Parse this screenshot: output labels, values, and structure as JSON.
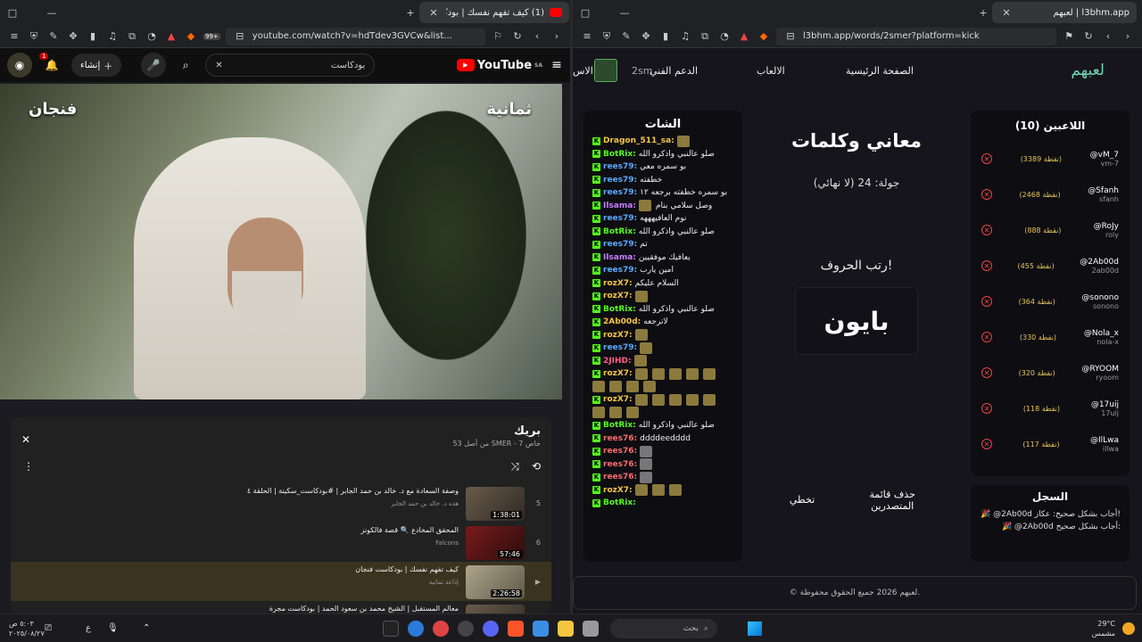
{
  "left_window": {
    "tab_title": "(1) كيف تفهم نفسك | بودكاست...",
    "url": "youtube.com/watch?v=hdTdev3GVCw&list...",
    "badge_count": "99+",
    "youtube": {
      "logo_text": "YouTube",
      "logo_region": "SA",
      "search_value": "بودكاست",
      "create_label": "إنشاء",
      "notification_count": "1",
      "video_label_left": "فنجان",
      "video_label_right": "ثمانية"
    },
    "playlist": {
      "title": "بريك",
      "subtitle": "خاص SMER - 7 من أصل 53",
      "items": [
        {
          "num": "5",
          "title": "وصفة السعادة مع د. خالد بن حمد الجابر | #بودكاست_سكينة | الحلقة ٤",
          "channel": "هذه د. خالد بن حمد الجابر",
          "duration": "1:38:01"
        },
        {
          "num": "6",
          "title": "المحقق المخادع 🔍 قصة فالكونز",
          "channel": "Falcons",
          "duration": "57:46"
        },
        {
          "num": "▶",
          "title": "كيف تفهم نفسك | بودكاست فنجان",
          "channel": "إذاعة ثمانية",
          "duration": "2:26:58"
        },
        {
          "num": "",
          "title": "معالم المستقبل | الشيخ محمد بن سعود الحمد | بودكاست مجرة",
          "channel": "",
          "duration": ""
        }
      ]
    }
  },
  "right_window": {
    "tab_title": "لعبهم | l3bhm.app",
    "url": "l3bhm.app/words/2smer?platform=kick",
    "site": {
      "logo": "لعبهم",
      "nav_home": "الصفحة الرئيسية",
      "nav_games": "الالعاب",
      "nav_support": "الدعم الفني",
      "nav_user": "2sm",
      "nav_cut": "الاس",
      "chat_title": "الشات",
      "game_title": "معاني وكلمات",
      "round_text": "جولة: 24 (لا نهائي)",
      "prompt": "رتب الحروف!",
      "word": "بايون",
      "action_delete": "حذف قائمة المتصدرين",
      "action_skip": "تخطي",
      "players_title": "اللاعبين (10)",
      "log_title": "السجل",
      "log_entries": [
        "🎉 @2Ab00d أجاب بشكل صحيح: عكاز!",
        "🎉 @2Ab00d أجاب بشكل صحيح:"
      ],
      "footer": "© لعبهم 2026 جميع الحقوق محفوظة."
    },
    "players": [
      {
        "name": "@vM_7",
        "user": "vm-7",
        "points": "(3389 نقطة)"
      },
      {
        "name": "@Sfanh",
        "user": "sfanh",
        "points": "(2468 نقطة)"
      },
      {
        "name": "@RoJy",
        "user": "roly",
        "points": "(888 نقطة)"
      },
      {
        "name": "@2Ab00d",
        "user": "2ab00d",
        "points": "(455 نقطة)"
      },
      {
        "name": "@sonono",
        "user": "sonono",
        "points": "(364 نقطة)"
      },
      {
        "name": "@Nola_x",
        "user": "nola-x",
        "points": "(330 نقطة)"
      },
      {
        "name": "@RYOOM",
        "user": "ryoom",
        "points": "(320 نقطة)"
      },
      {
        "name": "@17uij",
        "user": "17uij",
        "points": "(118 نقطة)"
      },
      {
        "name": "@IlLwa",
        "user": "illwa",
        "points": "(117 نقطة)"
      }
    ],
    "chat": [
      {
        "user": "Dragon_511_sa:",
        "color": "#f5c542",
        "text": "",
        "emotes": 1
      },
      {
        "user": "BotRix:",
        "color": "#53fc18",
        "text": "صلو عالنبي واذكرو الله",
        "emotes": 0
      },
      {
        "user": "rees79:",
        "color": "#5aa9ff",
        "text": "بو سمره معي",
        "emotes": 0
      },
      {
        "user": "rees79:",
        "color": "#5aa9ff",
        "text": "خطفته",
        "emotes": 0
      },
      {
        "user": "rees79:",
        "color": "#5aa9ff",
        "text": "بو سمره خطفته برجعه ١٢",
        "emotes": 0
      },
      {
        "user": "Ilsama:",
        "color": "#c77dff",
        "text": "وصل سلامي بنام",
        "emotes": 1
      },
      {
        "user": "rees79:",
        "color": "#5aa9ff",
        "text": "نوم العافيهههه",
        "emotes": 0
      },
      {
        "user": "BotRix:",
        "color": "#53fc18",
        "text": "صلو عالنبي واذكرو الله",
        "emotes": 0
      },
      {
        "user": "rees79:",
        "color": "#5aa9ff",
        "text": "تم",
        "emotes": 0
      },
      {
        "user": "Ilsama:",
        "color": "#c77dff",
        "text": "يعافيك موفقيين",
        "emotes": 0
      },
      {
        "user": "rees79:",
        "color": "#5aa9ff",
        "text": "امين يارب",
        "emotes": 0
      },
      {
        "user": "rozX7:",
        "color": "#f5c542",
        "text": "السلام عليكم",
        "emotes": 0
      },
      {
        "user": "rozX7:",
        "color": "#f5c542",
        "text": "",
        "emotes": 1
      },
      {
        "user": "BotRix:",
        "color": "#53fc18",
        "text": "صلو عالنبي واذكرو الله",
        "emotes": 0
      },
      {
        "user": "2Ab00d:",
        "color": "#f5c542",
        "text": "لاترجعه",
        "emotes": 0
      },
      {
        "user": "rozX7:",
        "color": "#f5c542",
        "text": "",
        "emotes": 1
      },
      {
        "user": "rees79:",
        "color": "#5aa9ff",
        "text": "",
        "emotes": 1
      },
      {
        "user": "2JIHD:",
        "color": "#ff5c8a",
        "text": "",
        "emotes": 1
      },
      {
        "user": "rozX7:",
        "color": "#f5c542",
        "text": "",
        "emotes": 5
      },
      {
        "user": "",
        "color": "#f5c542",
        "text": "",
        "emotes": 4
      },
      {
        "user": "rozX7:",
        "color": "#f5c542",
        "text": "",
        "emotes": 5
      },
      {
        "user": "",
        "color": "#f5c542",
        "text": "",
        "emotes": 3
      },
      {
        "user": "BotRix:",
        "color": "#53fc18",
        "text": "صلو عالنبي واذكرو الله",
        "emotes": 0
      },
      {
        "user": "rees76:",
        "color": "#ff6b6b",
        "text": "ddddeedddd",
        "emotes": 0
      },
      {
        "user": "rees76:",
        "color": "#ff6b6b",
        "text": "",
        "emotes": 1
      },
      {
        "user": "rees76:",
        "color": "#ff6b6b",
        "text": "",
        "emotes": 1
      },
      {
        "user": "rees76:",
        "color": "#ff6b6b",
        "text": "",
        "emotes": 1
      },
      {
        "user": "rozX7:",
        "color": "#f5c542",
        "text": "",
        "emotes": 3
      },
      {
        "user": "BotRix:",
        "color": "#53fc18",
        "text": "",
        "emotes": 0
      }
    ]
  },
  "taskbar": {
    "temperature": "29°C",
    "weather": "مشمس",
    "search_placeholder": "بحث",
    "time": "٥:٠٣ ص",
    "date": "٢٠٢٥/٠٨/٢٧",
    "lang": "ع"
  }
}
